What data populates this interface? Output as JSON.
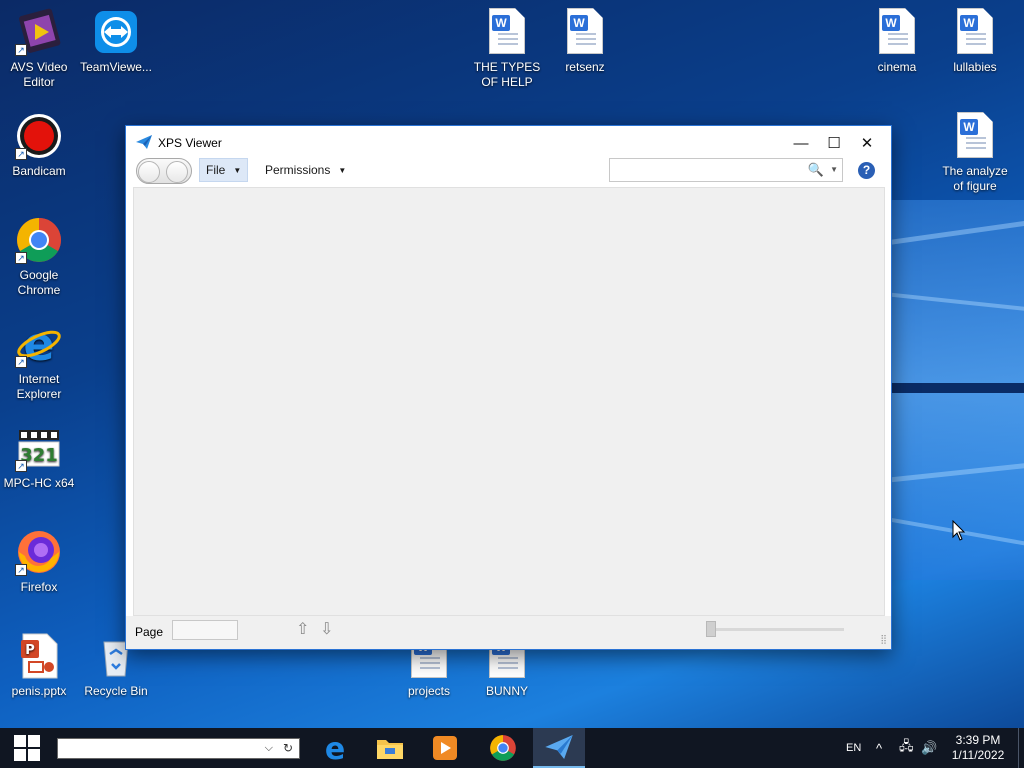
{
  "desktop": {
    "icons_left": [
      {
        "label": "AVS Video Editor",
        "icon": "avs-video-editor-icon"
      },
      {
        "label": "Bandicam",
        "icon": "bandicam-icon"
      },
      {
        "label": "Google Chrome",
        "icon": "chrome-icon"
      },
      {
        "label": "Internet Explorer",
        "icon": "internet-explorer-icon"
      },
      {
        "label": "MPC-HC x64",
        "icon": "mpc-hc-icon"
      },
      {
        "label": "Firefox",
        "icon": "firefox-icon"
      },
      {
        "label": "penis.pptx",
        "icon": "powerpoint-file-icon"
      }
    ],
    "teamviewer": {
      "label": "TeamViewe...",
      "icon": "teamviewer-icon"
    },
    "recycle_bin": {
      "label": "Recycle Bin",
      "icon": "recycle-bin-icon"
    },
    "docs_top": [
      {
        "label": "THE TYPES OF HELP"
      },
      {
        "label": "retsenz"
      },
      {
        "label": "cinema"
      },
      {
        "label": "lullabies"
      },
      {
        "label": "The analyze of figure"
      }
    ],
    "docs_bottom": [
      {
        "label": "projects"
      },
      {
        "label": "BUNNY"
      }
    ],
    "doc_letter": "W",
    "shortcut_glyph": "↗"
  },
  "window": {
    "title": "XPS Viewer",
    "menus": {
      "file": "File",
      "permissions": "Permissions"
    },
    "dropdown_glyph": "▼",
    "controls": {
      "minimize": "—",
      "maximize": "☐",
      "close": "✕"
    },
    "search": {
      "placeholder": "",
      "search_glyph": "🔍",
      "dropdown_glyph": "▼"
    },
    "help_glyph": "?",
    "status": {
      "page_label": "Page",
      "page_value": "",
      "up_glyph": "⇧",
      "down_glyph": "⇩",
      "grip_glyph": "⣿"
    }
  },
  "taskbar": {
    "search_value": "",
    "search_chevron": "⌵",
    "search_refresh": "↻",
    "tray": {
      "language": "EN",
      "chevron": "^",
      "network_glyph": "🖧",
      "volume_glyph": "🔊"
    },
    "clock": {
      "time": "3:39 PM",
      "date": "1/11/2022"
    }
  },
  "colors": {
    "taskbar": "#101622",
    "accent": "#2a73d4",
    "doc_badge": "#2b6fd8"
  }
}
